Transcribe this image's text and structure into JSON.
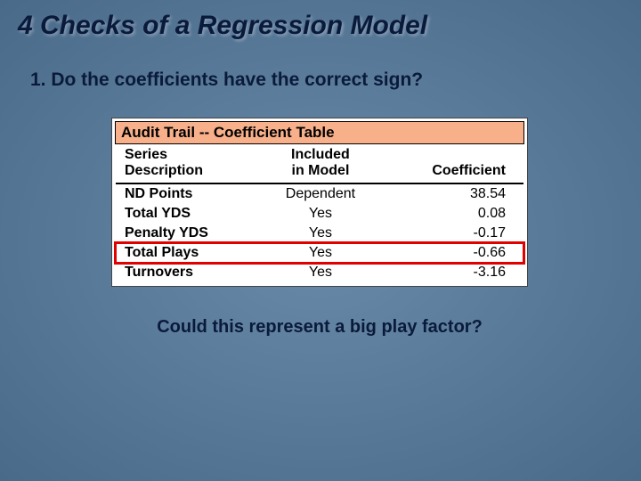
{
  "title": "4 Checks of a Regression Model",
  "question": "1.  Do the coefficients have the correct sign?",
  "table": {
    "heading": "Audit Trail -- Coefficient Table",
    "header1": {
      "c1": "Series",
      "c2": "Included",
      "c3": ""
    },
    "header2": {
      "c1": "Description",
      "c2": "in Model",
      "c3": "Coefficient"
    },
    "rows": [
      {
        "series": "ND Points",
        "included": "Dependent",
        "coef": "38.54",
        "hl": false
      },
      {
        "series": "Total YDS",
        "included": "Yes",
        "coef": "0.08",
        "hl": false
      },
      {
        "series": "Penalty YDS",
        "included": "Yes",
        "coef": "-0.17",
        "hl": false
      },
      {
        "series": "Total Plays",
        "included": "Yes",
        "coef": "-0.66",
        "hl": true
      },
      {
        "series": "Turnovers",
        "included": "Yes",
        "coef": "-3.16",
        "hl": false
      }
    ]
  },
  "footer": "Could this represent a big play factor?"
}
